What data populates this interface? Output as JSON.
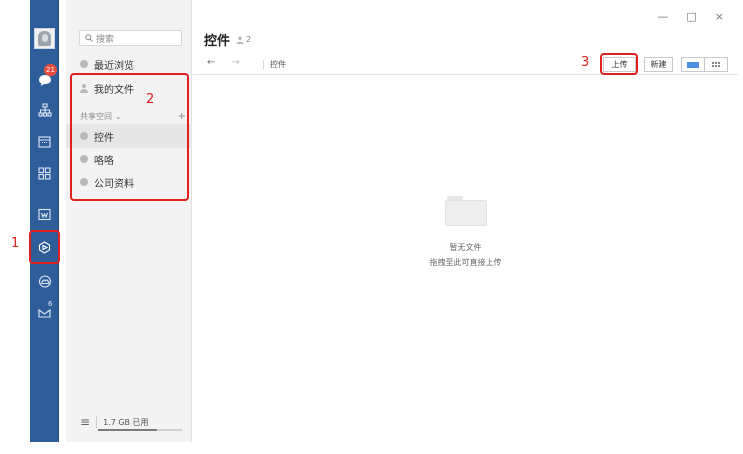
{
  "rail": {
    "chat_badge": "21",
    "mail_count": "6",
    "icons": [
      "avatar",
      "chat-icon",
      "org-icon",
      "calendar-icon",
      "apps-icon",
      "doc-icon",
      "drive-icon",
      "cloud-icon",
      "mail-icon"
    ]
  },
  "sidebar": {
    "search_placeholder": "搜索",
    "recent": "最近浏览",
    "my_files": "我的文件",
    "shared_space": "共享空间",
    "shared_chevron": "⌄",
    "add": "+",
    "items": [
      {
        "label": "控件"
      },
      {
        "label": "咯咯"
      },
      {
        "label": "公司资料"
      }
    ],
    "storage": "1.7 GB 已用",
    "menu_icon": "≡"
  },
  "main": {
    "title": "控件",
    "members": "2",
    "back": "←",
    "forward": "→",
    "breadcrumb": "控件",
    "upload": "上传",
    "new": "新建",
    "window_controls": [
      "—",
      "□",
      "×"
    ],
    "empty_title": "暂无文件",
    "empty_hint": "拖拽至此可直接上传"
  },
  "annotations": {
    "n1": "1",
    "n2": "2",
    "n3": "3",
    "color": "#e01f1f"
  }
}
